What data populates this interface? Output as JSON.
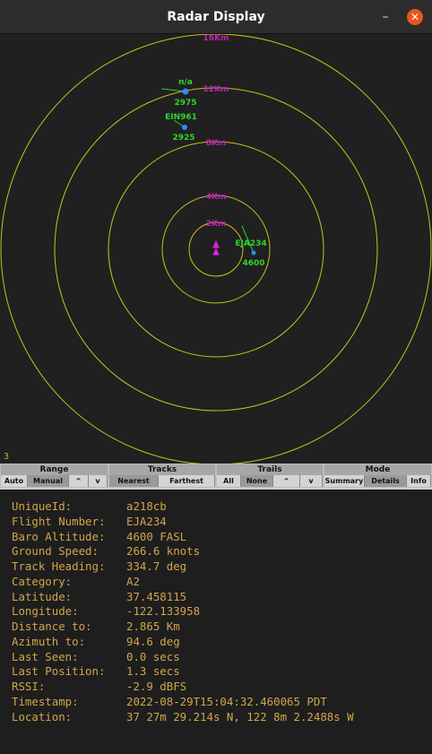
{
  "window": {
    "title": "Radar Display",
    "minimize_glyph": "–",
    "close_glyph": "✕"
  },
  "radar": {
    "ring_labels": [
      "2Km",
      "4Km",
      "8Km",
      "12Km",
      "16Km"
    ],
    "corner_value": "3",
    "aircraft": [
      {
        "callsign": "n/a",
        "altitude": "2975",
        "color": "#2bd62b"
      },
      {
        "callsign": "EIN961",
        "altitude": "2925",
        "color": "#2bd62b"
      },
      {
        "callsign": "EJA234",
        "altitude": "4600",
        "color": "#2bd62b"
      }
    ],
    "colors": {
      "ring": "#c7c21a",
      "range_label": "#c020c0",
      "aircraft": "#2bd62b",
      "aircraft_dot": "#2a8cff",
      "own_ship": "#e81ee8"
    }
  },
  "controls": {
    "groups": [
      {
        "title": "Range",
        "buttons": [
          "Auto",
          "Manual",
          "^",
          "v"
        ]
      },
      {
        "title": "Tracks",
        "buttons": [
          "Nearest",
          "Farthest"
        ]
      },
      {
        "title": "Trails",
        "buttons": [
          "All",
          "None",
          "^",
          "v"
        ]
      },
      {
        "title": "Mode",
        "buttons": [
          "Summary",
          "Details",
          "Info"
        ]
      }
    ]
  },
  "details": [
    {
      "key": "UniqueId:",
      "value": "a218cb"
    },
    {
      "key": "Flight Number:",
      "value": "EJA234"
    },
    {
      "key": "Baro Altitude:",
      "value": "4600 FASL"
    },
    {
      "key": "Ground Speed:",
      "value": "266.6 knots"
    },
    {
      "key": "Track Heading:",
      "value": "334.7 deg"
    },
    {
      "key": "Category:",
      "value": "A2"
    },
    {
      "key": "Latitude:",
      "value": "37.458115"
    },
    {
      "key": "Longitude:",
      "value": "-122.133958"
    },
    {
      "key": "Distance to:",
      "value": "2.865 Km"
    },
    {
      "key": "Azimuth to:",
      "value": "94.6 deg"
    },
    {
      "key": "Last Seen:",
      "value": "0.0 secs"
    },
    {
      "key": "Last Position:",
      "value": "1.3 secs"
    },
    {
      "key": "RSSI:",
      "value": "-2.9 dBFS"
    },
    {
      "key": "Timestamp:",
      "value": "2022-08-29T15:04:32.460065 PDT"
    },
    {
      "key": "Location:",
      "value": "37 27m 29.214s N, 122 8m 2.2488s W"
    }
  ]
}
